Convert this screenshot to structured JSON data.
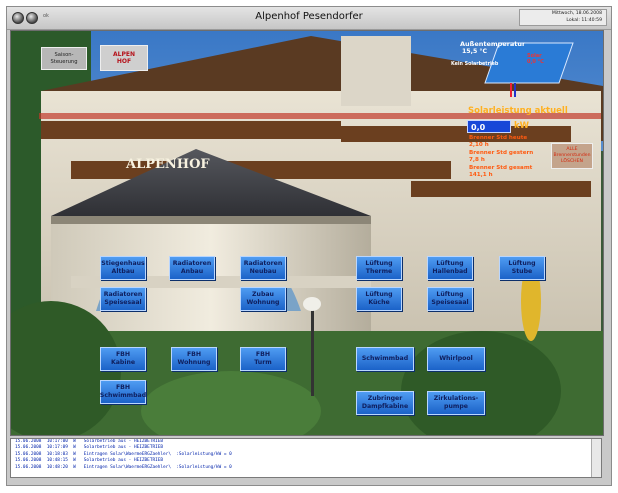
{
  "window": {
    "title": "Alpenhof Pesendorfer",
    "ok_label": "ok",
    "date_line": "Mittwoch, 18.06.2008",
    "time_line": "Lokal: 11:40:59"
  },
  "top_controls": {
    "season_button": "Saison-\nSteuerung",
    "logo_label": "ALPEN\nHOF"
  },
  "building_sign": "ALPENHOF",
  "weather": {
    "temp_label": "Außentemperatur",
    "temp_value": "15,5 °C",
    "solar_status": "Kein Solarbetrieb",
    "panel_label": "Solar\n0,0 °C"
  },
  "solar": {
    "title": "Solarleistung aktuell",
    "power_value": "0,0",
    "power_unit": "kW",
    "burner_today_label": "Brenner Std heute",
    "burner_today_value": "2,10 h",
    "burner_yesterday_label": "Brenner Std gestern",
    "burner_yesterday_value": "7,8 h",
    "burner_total_label": "Brenner Std gesamt",
    "burner_total_value": "141,1 h",
    "reset_button": "ALLE\nBrennerstunden\nLÖSCHEN"
  },
  "buttons": {
    "stiegenhaus": "Stiegenhaus\nAltbau",
    "radiatoren_anbau": "Radiatoren\nAnbau",
    "radiatoren_neubau": "Radiatoren\nNeubau",
    "lueftung_therme": "Lüftung\nTherme",
    "lueftung_hallenbad": "Lüftung\nHallenbad",
    "lueftung_stube": "Lüftung\nStube",
    "radiatoren_speisesaal": "Radiatoren\nSpeisesaal",
    "zubau_wohnung": "Zubau\nWohnung",
    "lueftung_kueche": "Lüftung\nKüche",
    "lueftung_speisesaal": "Lüftung\nSpeisesaal",
    "fbh_kabine": "FBH\nKabine",
    "fbh_wohnung": "FBH\nWohnung",
    "fbh_turm": "FBH\nTurm",
    "schwimmbad": "Schwimmbad",
    "whirlpool": "Whirlpool",
    "fbh_schwimmbad": "FBH\nSchwimmbad",
    "zubringer": "Zubringer\nDampfkabine",
    "zirkulation": "Zirkulations-\npumpe"
  },
  "log_lines": [
    "15.06.2008  10:17:00  W   Solarbetrieb aus - HEIZBETRIEB",
    "15.06.2008  10:17:09  W   Solarbetrieb aus - HEIZBETRIEB",
    "15.06.2008  10:18:03  W   Eintragen Solar\\WaermeERGZaehler\\  :Solarleistung/kW = 0",
    "15.06.2008  10:48:15  W   Solarbetrieb aus - HEIZBETRIEB",
    "15.06.2008  10:48:20  W   Eintragen Solar\\WaermeERGZaehler\\  :Solarleistung/kW = 0"
  ],
  "colors": {
    "button_blue": "#2a77dd",
    "solar_orange": "#ff9a1a",
    "info_orange": "#ff5a10"
  }
}
